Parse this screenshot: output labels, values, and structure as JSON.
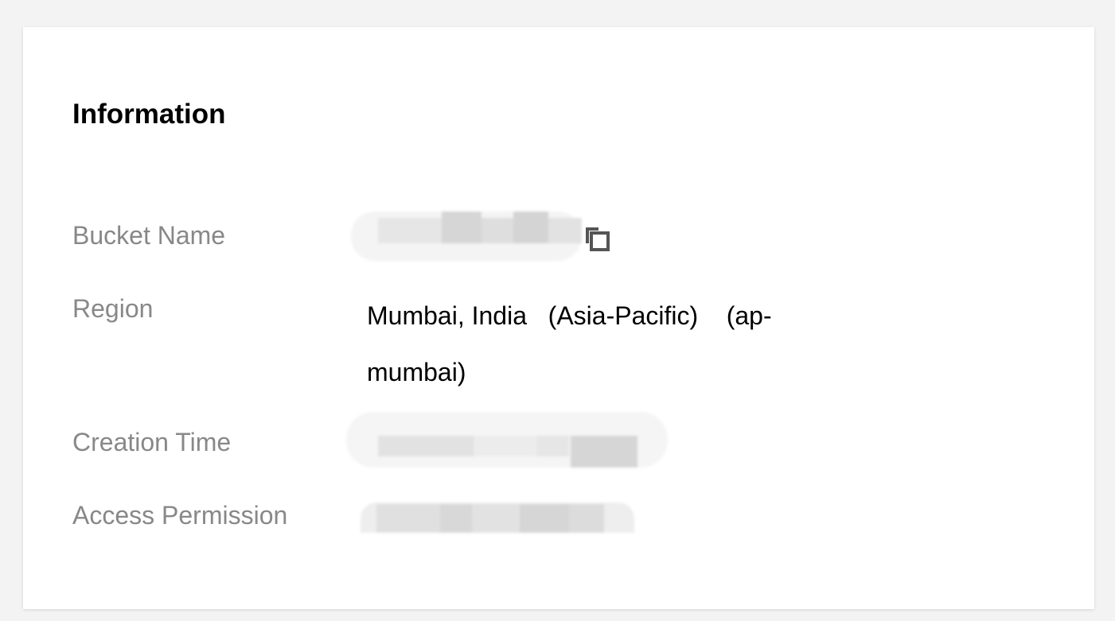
{
  "card": {
    "title": "Information"
  },
  "fields": {
    "bucket_name": {
      "label": "Bucket Name",
      "value": ""
    },
    "region": {
      "label": "Region",
      "value_line1": "Mumbai, India   (Asia-Pacific)    (ap-",
      "value_line2": "mumbai)"
    },
    "creation_time": {
      "label": "Creation Time",
      "value": ""
    },
    "access_permission": {
      "label": "Access Permission",
      "value": ""
    }
  },
  "icons": {
    "copy": "copy-icon"
  },
  "colors": {
    "background": "#f3f3f3",
    "card": "#ffffff",
    "label": "#888888",
    "value": "#000000",
    "icon": "#555555"
  }
}
